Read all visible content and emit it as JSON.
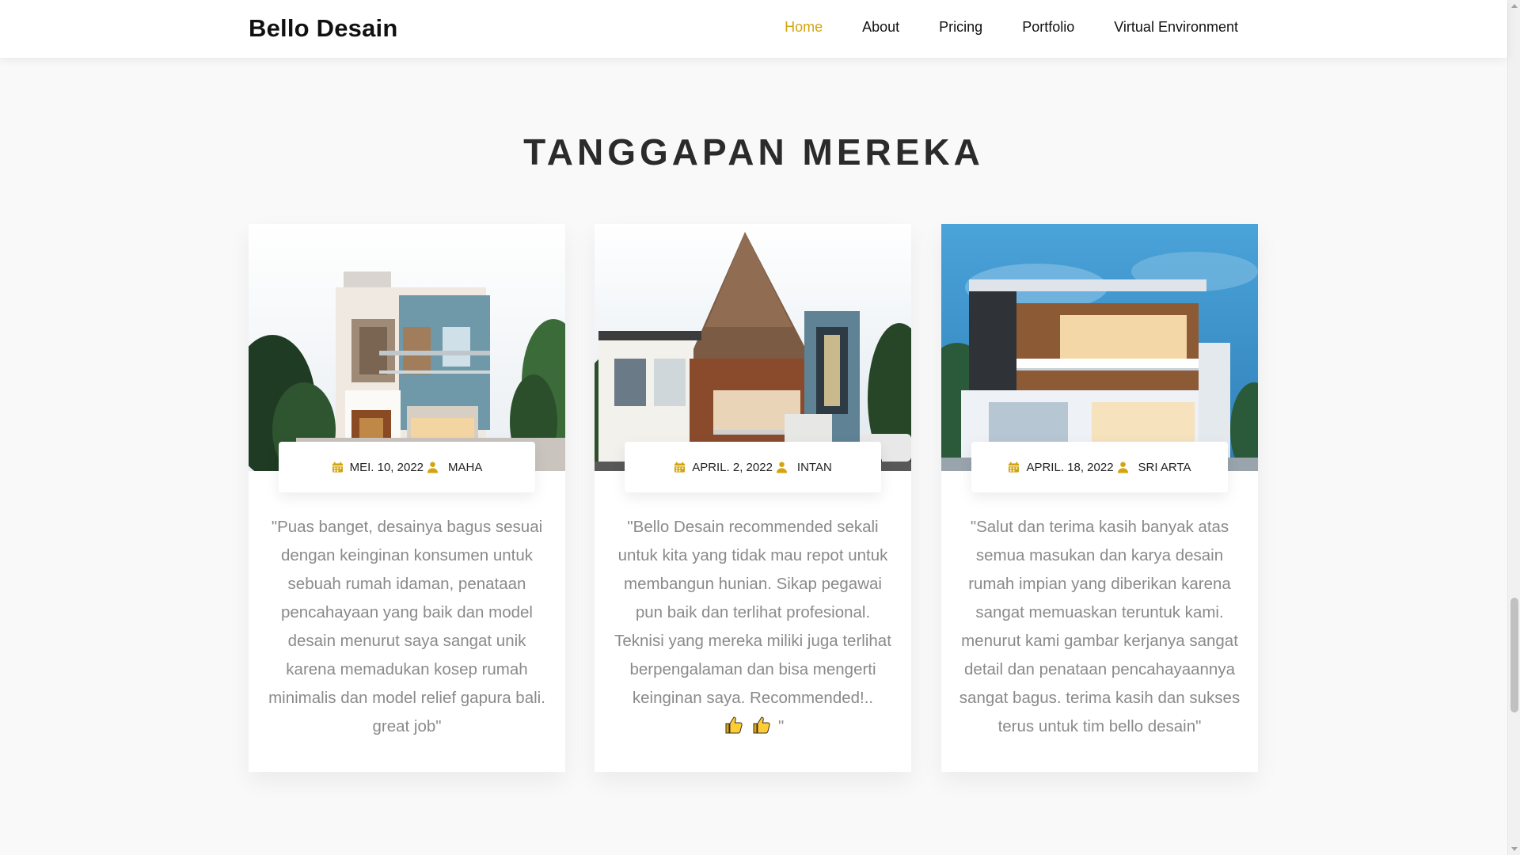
{
  "header": {
    "brand": "Bello Desain",
    "nav": [
      "Home",
      "About",
      "Pricing",
      "Portfolio",
      "Virtual Environment"
    ],
    "active": "Home"
  },
  "section": {
    "title": "TANGGAPAN MEREKA"
  },
  "cards": [
    {
      "date": "MEI. 10, 2022",
      "author": "MAHA",
      "text": "\"Puas banget, desainya bagus sesuai dengan keinginan konsumen untuk sebuah rumah idaman, penataan pencahayaan yang baik dan model desain menurut saya sangat unik karena memadukan kosep rumah minimalis dan model relief gapura bali. great job\""
    },
    {
      "date": "APRIL. 2, 2022",
      "author": "INTAN",
      "text": "\"Bello Desain recommended sekali untuk kita yang tidak mau repot untuk membangun hunian. Sikap pegawai pun baik dan terlihat profesional. Teknisi yang mereka miliki juga terlihat berpengalaman dan bisa mengerti keinginan saya. Recommended!..",
      "text_tail": " \""
    },
    {
      "date": "APRIL. 18, 2022",
      "author": "SRI ARTA",
      "text": "\"Salut dan terima kasih banyak atas semua masukan dan karya desain rumah impian yang diberikan karena sangat memuaskan teruntuk kami. menurut kami gambar kerjanya sangat detail dan penataan pencahayaannya sangat bagus. terima kasih dan sukses terus untuk tim bello desain\""
    }
  ],
  "colors": {
    "accent": "#d4a40f",
    "text_muted": "#8a8a8a",
    "background": "#f9f9f9"
  },
  "icons": [
    "calendar-icon",
    "user-icon",
    "thumbs-up-icon"
  ]
}
